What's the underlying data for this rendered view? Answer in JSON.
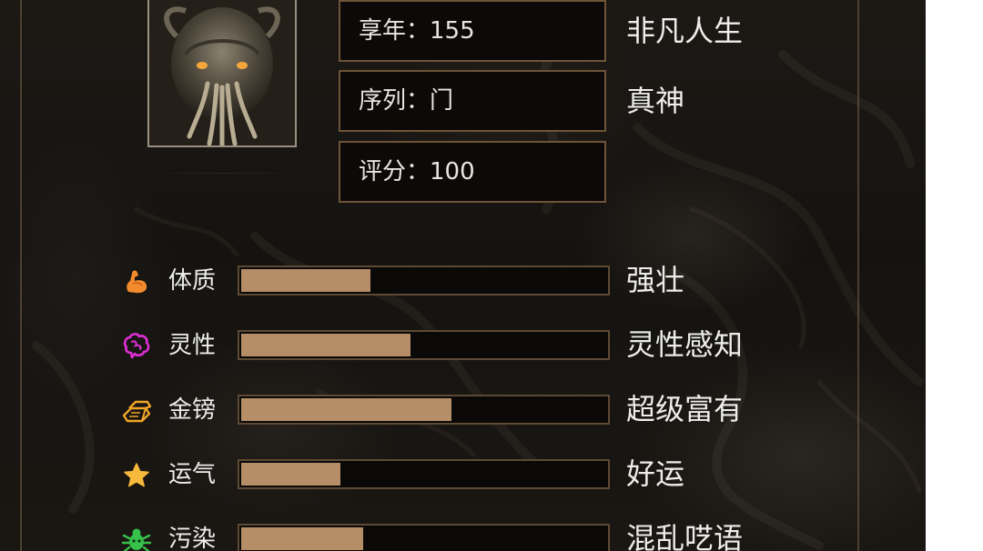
{
  "info": [
    {
      "label": "享年：155",
      "side": "非凡人生"
    },
    {
      "label": "序列：门",
      "side": "真神"
    },
    {
      "label": "评分：100",
      "side": ""
    }
  ],
  "stats": [
    {
      "name": "体质",
      "icon": "muscle-icon",
      "fill_fraction": 0.35,
      "desc": "强壮",
      "icon_color": "#f28a2e"
    },
    {
      "name": "灵性",
      "icon": "brain-icon",
      "fill_fraction": 0.46,
      "desc": "灵性感知",
      "icon_color": "#e02fd6"
    },
    {
      "name": "金镑",
      "icon": "gold-bars-icon",
      "fill_fraction": 0.57,
      "desc": "超级富有",
      "icon_color": "#f0a528"
    },
    {
      "name": "运气",
      "icon": "star-icon",
      "fill_fraction": 0.27,
      "desc": "好运",
      "icon_color": "#f6b93b"
    },
    {
      "name": "污染",
      "icon": "bug-icon",
      "fill_fraction": 0.33,
      "desc": "混乱呓语",
      "icon_color": "#36c24a"
    }
  ],
  "colors": {
    "bar_fill": "#b58d66",
    "bar_border": "#5e4a34",
    "box_border": "#6e5438"
  }
}
